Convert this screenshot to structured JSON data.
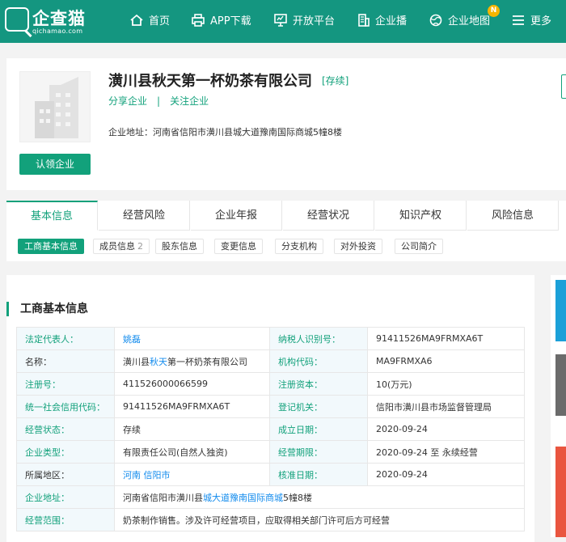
{
  "nav": {
    "logo_name": "企查猫",
    "logo_domain": "qichamao.com",
    "items": [
      {
        "label": "首页",
        "icon": "home-icon"
      },
      {
        "label": "APP下载",
        "icon": "printer-icon"
      },
      {
        "label": "开放平台",
        "icon": "monitor-icon"
      },
      {
        "label": "企业播",
        "icon": "building-icon"
      },
      {
        "label": "企业地图",
        "icon": "globe-icon",
        "badge": "N"
      },
      {
        "label": "更多",
        "icon": "menu-icon"
      }
    ]
  },
  "company": {
    "name": "潢川县秋天第一杯奶茶有限公司",
    "status": "[存续]",
    "share": "分享企业",
    "sep": "|",
    "follow": "关注企业",
    "address_label": "企业地址：",
    "address": "河南省信阳市潢川县城大道豫南国际商城5幢8楼",
    "claim": "认领企业"
  },
  "tabs": [
    "基本信息",
    "经营风险",
    "企业年报",
    "经营状况",
    "知识产权",
    "风险信息"
  ],
  "subtabs": [
    {
      "label": "工商基本信息",
      "count": ""
    },
    {
      "label": "成员信息",
      "count": "2"
    },
    {
      "label": "股东信息",
      "count": ""
    },
    {
      "label": "变更信息",
      "count": ""
    },
    {
      "label": "分支机构",
      "count": ""
    },
    {
      "label": "对外投资",
      "count": ""
    },
    {
      "label": "公司简介",
      "count": ""
    }
  ],
  "section_title": "工商基本信息",
  "info": {
    "legal_rep_label": "法定代表人：",
    "legal_rep": "姚磊",
    "tax_id_label": "纳税人识别号：",
    "tax_id": "91411526MA9FRMXA6T",
    "name_label": "名称：",
    "name_pre": "潢川县",
    "name_hl": "秋天",
    "name_post": "第一杯奶茶有限公司",
    "org_code_label": "机构代码：",
    "org_code": "MA9FRMXA6",
    "reg_no_label": "注册号：",
    "reg_no": "411526000066599",
    "capital_label": "注册资本：",
    "capital": "10(万元)",
    "credit_code_label": "统一社会信用代码：",
    "credit_code": "91411526MA9FRMXA6T",
    "authority_label": "登记机关：",
    "authority": "信阳市潢川县市场监督管理局",
    "state_label": "经营状态：",
    "state": "存续",
    "founded_label": "成立日期：",
    "founded": "2020-09-24",
    "type_label": "企业类型：",
    "type": "有限责任公司(自然人独资)",
    "term_label": "经营期限：",
    "term": "2020-09-24 至 永续经营",
    "region_label": "所属地区：",
    "region": "河南 信阳市",
    "approved_label": "核准日期：",
    "approved": "2020-09-24",
    "addr_label": "企业地址：",
    "addr_pre": "河南省信阳市潢川县",
    "addr_hl": "城大道豫南国际商城",
    "addr_post": "5幢8楼",
    "scope_label": "经营范围：",
    "scope": "奶茶制作销售。涉及许可经营项目，应取得相关部门许可后方可经营"
  },
  "colors": {
    "nav_bg": "#149680",
    "accent": "#12a17b",
    "link": "#128bed"
  }
}
